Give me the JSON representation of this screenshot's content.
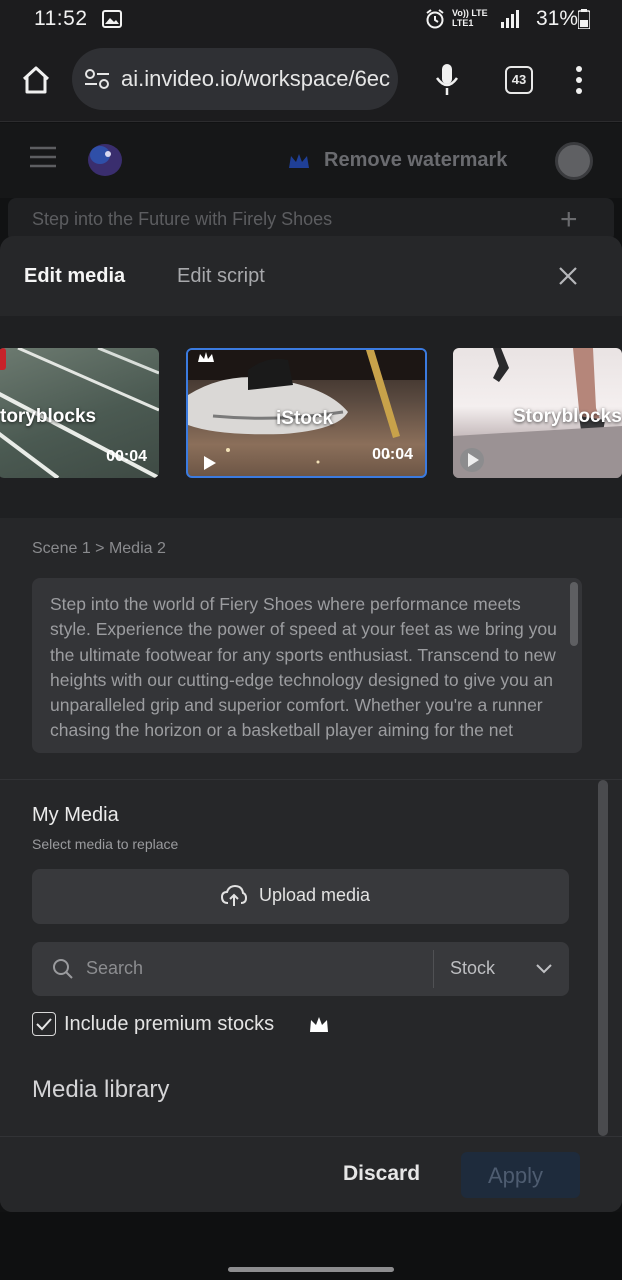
{
  "status_bar": {
    "time": "11:52",
    "network_top": "Vo)) LTE",
    "network_bottom": "LTE1",
    "battery": "31%"
  },
  "browser": {
    "url": "ai.invideo.io/workspace/6ec",
    "tab_count": "43"
  },
  "app_header": {
    "watermark_label": "Remove watermark"
  },
  "project": {
    "title": "Step into the Future with Firely Shoes"
  },
  "modal": {
    "tabs": [
      {
        "label": "Edit media",
        "active": true
      },
      {
        "label": "Edit script",
        "active": false
      }
    ],
    "thumbnails": [
      {
        "label": "toryblocks",
        "duration": "00:04",
        "selected": false
      },
      {
        "label": "iStock",
        "duration": "00:04",
        "selected": true
      },
      {
        "label": "Storyblocks",
        "duration": "",
        "selected": false
      }
    ],
    "breadcrumb": "Scene 1 > Media 2",
    "script_text": "Step into the world of Fiery Shoes where performance meets style. Experience the power of speed at your feet as we bring you the ultimate footwear for any sports enthusiast. Transcend to new heights with our cutting-edge technology designed to give you an unparalleled grip and superior comfort. Whether you're a runner chasing the horizon or a basketball player aiming for the net",
    "my_media": {
      "title": "My Media",
      "subtitle": "Select media to replace"
    },
    "upload_label": "Upload media",
    "search": {
      "placeholder": "Search",
      "filter": "Stock"
    },
    "premium": {
      "label": "Include premium stocks",
      "checked": true
    },
    "media_library_title": "Media library",
    "footer": {
      "discard": "Discard",
      "apply": "Apply"
    }
  },
  "colors": {
    "accent_blue": "#3b7be0",
    "apply_bg": "#1e2b3c",
    "crown_blue": "#2e5bd8"
  }
}
